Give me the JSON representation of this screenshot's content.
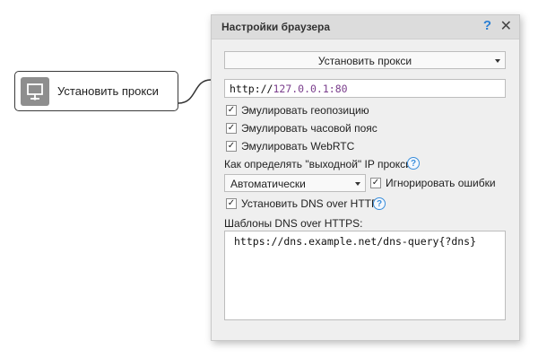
{
  "canvas": {
    "node": {
      "label": "Установить прокси",
      "icon": "monitor-network-icon"
    }
  },
  "dialog": {
    "title": "Настройки браузера",
    "help": "?",
    "close": "✕",
    "action": {
      "selected": "Установить прокси"
    },
    "proxy": {
      "prefix": "http://",
      "value_rest": "127.0.0.1:80"
    },
    "options": {
      "geo": {
        "label": "Эмулировать геопозицию",
        "checked": true
      },
      "timezone": {
        "label": "Эмулировать часовой пояс",
        "checked": true
      },
      "webrtc": {
        "label": "Эмулировать WebRTC",
        "checked": true
      }
    },
    "ip_detect": {
      "label": "Как определять \"выходной\" IP прокси:",
      "mode": "Автоматически",
      "ignore_errors": {
        "label": "Игнорировать ошибки",
        "checked": true
      }
    },
    "dns": {
      "set_label": "Установить DNS over HTTPS",
      "set_checked": true,
      "templates_label": "Шаблоны DNS over HTTPS:",
      "templates_value": "https://dns.example.net/dns-query{?dns}"
    },
    "check_glyph": "✓",
    "help_glyph": "?"
  }
}
